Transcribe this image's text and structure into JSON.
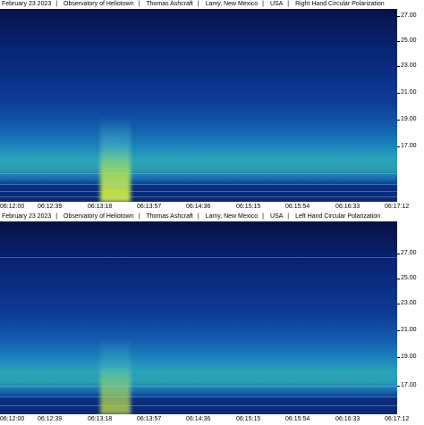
{
  "panels": [
    {
      "header": {
        "date": "February 23 2023",
        "observatory": "Observatory of Heliotown",
        "observer": "Thomas Ashcraft",
        "location": "Lamy, New Mexico",
        "country": "USA",
        "polarization": "Right Hand Circular Polarization"
      },
      "y_ticks": [
        "27.00",
        "25.00",
        "23.00",
        "21.00",
        "19.00",
        "17.00"
      ],
      "x_ticks": [
        "06:12:00",
        "06:12:39",
        "06:13:18",
        "06:13:57",
        "06:14:36",
        "06:15:15",
        "06:15:54",
        "06:16:33",
        "06:17:12"
      ]
    },
    {
      "header": {
        "date": "February 23 2023",
        "observatory": "Observatory of Heliotown",
        "observer": "Thomas Ashcraft",
        "location": "Lamy, New Mexico",
        "country": "USA",
        "polarization": "Left Hand Circular Polarization"
      },
      "y_ticks": [
        "27.00",
        "25.00",
        "23.00",
        "21.00",
        "19.00",
        "17.00"
      ],
      "x_ticks": [
        "06:12:00",
        "06:12:39",
        "06:13:18",
        "06:13:57",
        "06:14:36",
        "06:15:15",
        "06:15:54",
        "06:16:33",
        "06:17:12"
      ]
    }
  ],
  "colors": {
    "background_dark": "#061046",
    "band_cyan": "#2aa4b8",
    "burst_yellow": "#dcf03c"
  }
}
